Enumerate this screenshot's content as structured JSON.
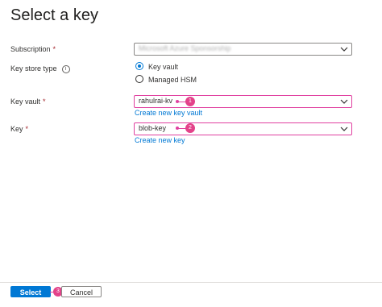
{
  "header": {
    "title": "Select a key",
    "more_label": "···"
  },
  "form": {
    "subscription": {
      "label": "Subscription",
      "value": "Microsoft Azure Sponsorship"
    },
    "key_store_type": {
      "label": "Key store type",
      "info_glyph": "i",
      "options": [
        {
          "label": "Key vault",
          "selected": true
        },
        {
          "label": "Managed HSM",
          "selected": false
        }
      ]
    },
    "key_vault": {
      "label": "Key vault",
      "value": "rahulrai-kv",
      "create_link": "Create new key vault"
    },
    "key": {
      "label": "Key",
      "value": "blob-key",
      "create_link": "Create new key"
    }
  },
  "required_marker": "*",
  "callouts": [
    "1",
    "2",
    "3"
  ],
  "footer": {
    "select_label": "Select",
    "cancel_label": "Cancel"
  },
  "colors": {
    "accent": "#0078d4",
    "callout": "#e3428a",
    "required": "#a4262c"
  },
  "icons": [
    "more-icon",
    "info-icon",
    "chevron-down-icon"
  ]
}
